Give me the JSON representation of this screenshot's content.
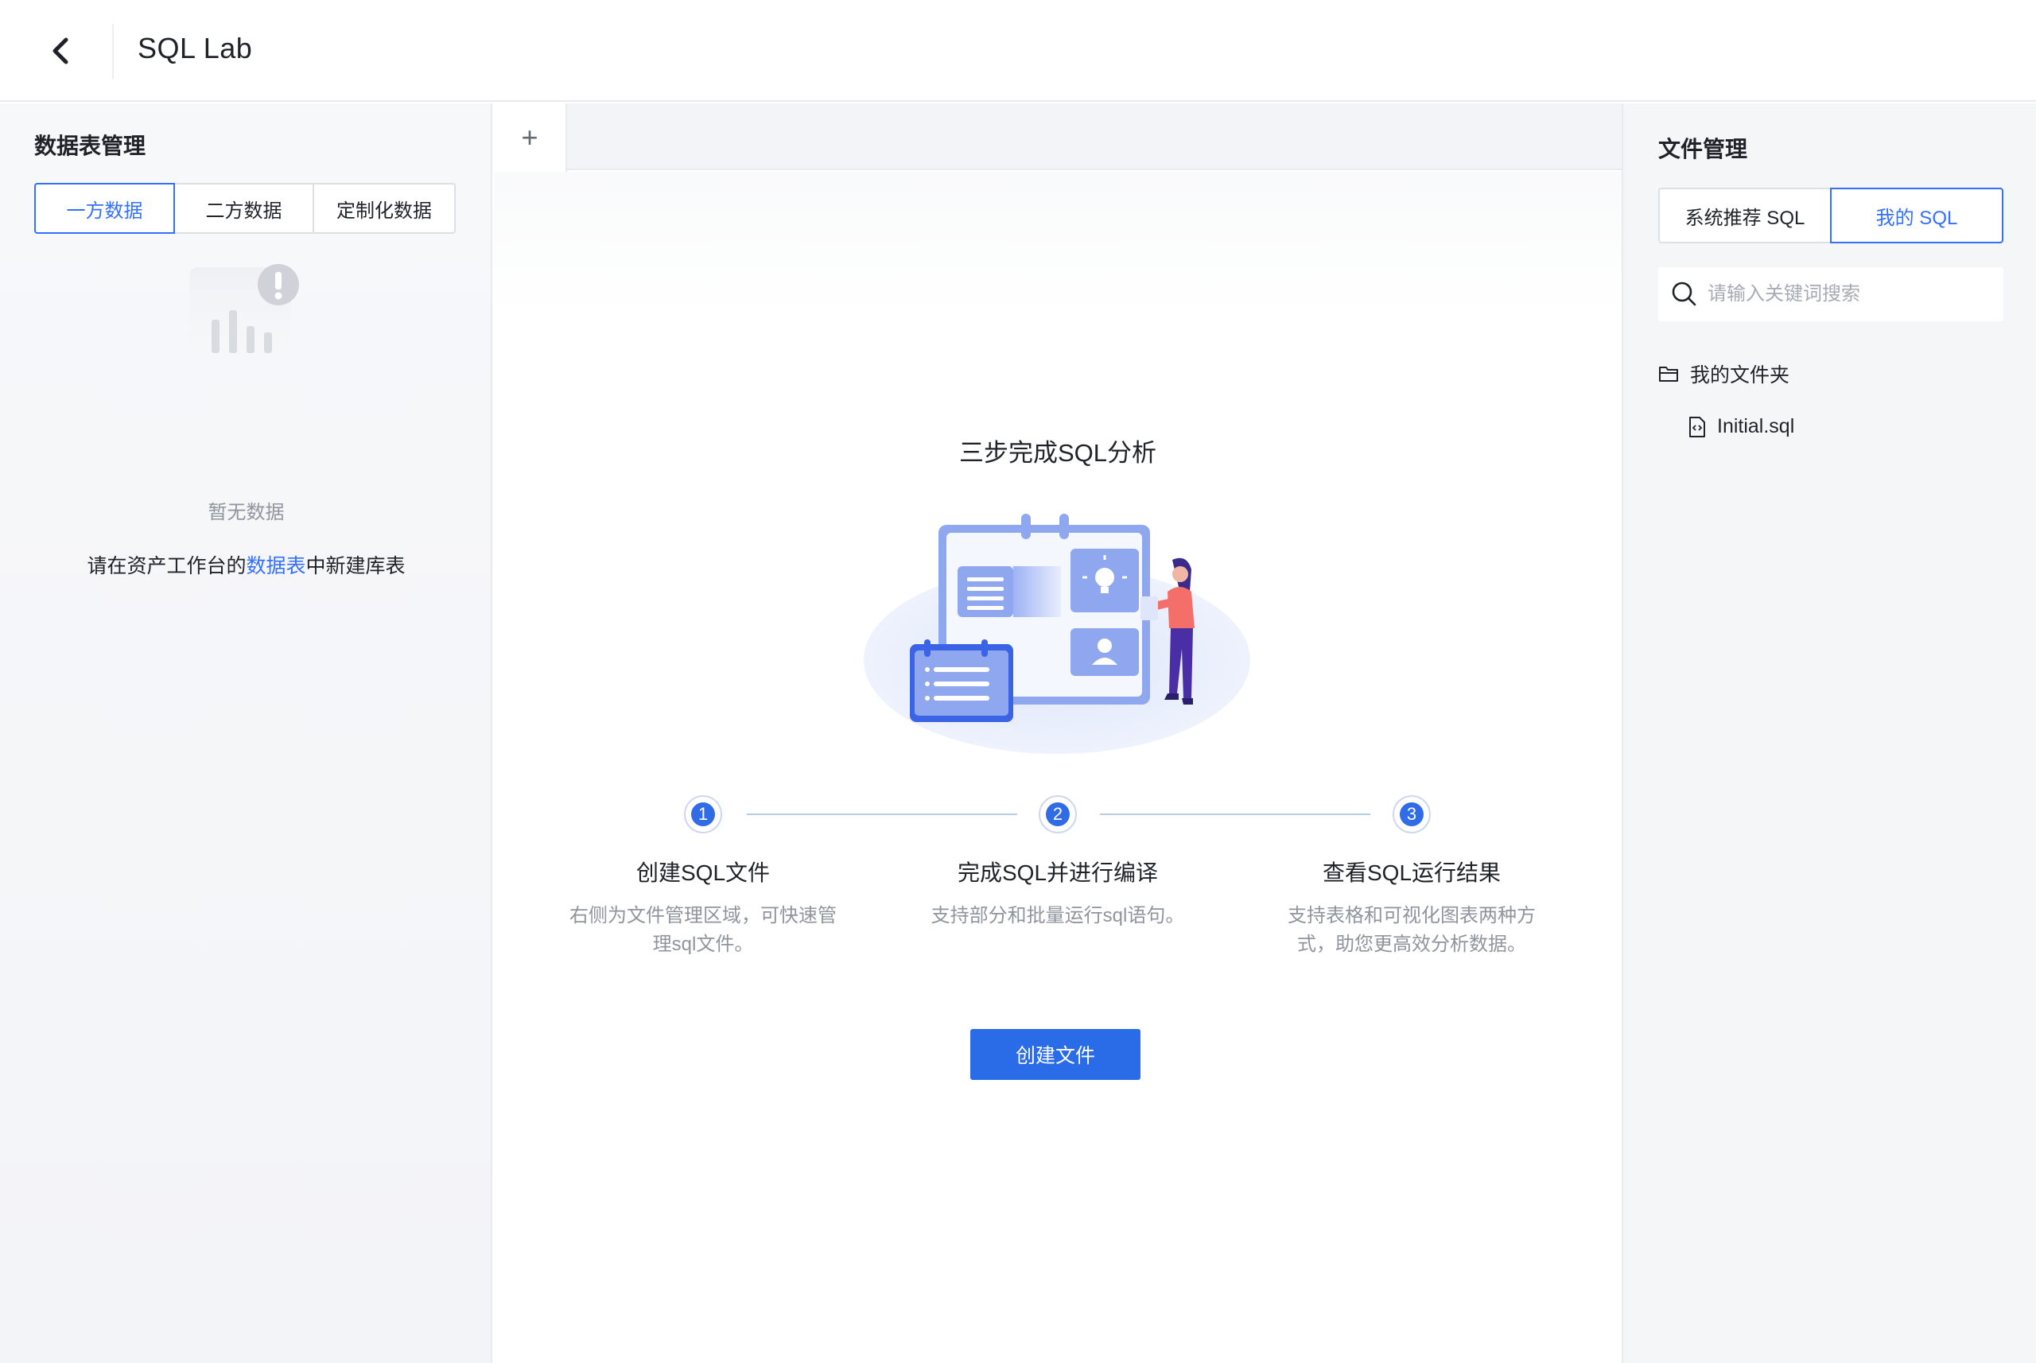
{
  "header": {
    "title": "SQL Lab",
    "back_icon": "chevron-left-icon"
  },
  "left_panel": {
    "title": "数据表管理",
    "tabs": [
      {
        "label": "一方数据",
        "active": true
      },
      {
        "label": "二方数据",
        "active": false
      },
      {
        "label": "定制化数据",
        "active": false
      }
    ],
    "empty_text": "暂无数据",
    "hint_prefix": "请在资产工作台的",
    "hint_link": "数据表",
    "hint_suffix": "中新建库表"
  },
  "center": {
    "add_tab_label": "+",
    "guide_title": "三步完成SQL分析",
    "steps": [
      {
        "number": "1",
        "title": "创建SQL文件",
        "desc_line1": "右侧为文件管理区域，可快速管",
        "desc_line2": "理sql文件。"
      },
      {
        "number": "2",
        "title": "完成SQL并进行编译",
        "desc_line1": "支持部分和批量运行sql语句。",
        "desc_line2": ""
      },
      {
        "number": "3",
        "title": "查看SQL运行结果",
        "desc_line1": "支持表格和可视化图表两种方",
        "desc_line2": "式，助您更高效分析数据。"
      }
    ],
    "create_button": "创建文件"
  },
  "right_panel": {
    "title": "文件管理",
    "tabs": [
      {
        "label": "系统推荐 SQL",
        "active": false
      },
      {
        "label": "我的 SQL",
        "active": true
      }
    ],
    "search_placeholder": "请输入关键词搜索",
    "tree": {
      "folder_label": "我的文件夹",
      "files": [
        {
          "label": "Initial.sql"
        }
      ]
    }
  },
  "colors": {
    "primary": "#2a6be8",
    "border": "#dcdfe6",
    "muted_text": "#8f959e"
  }
}
